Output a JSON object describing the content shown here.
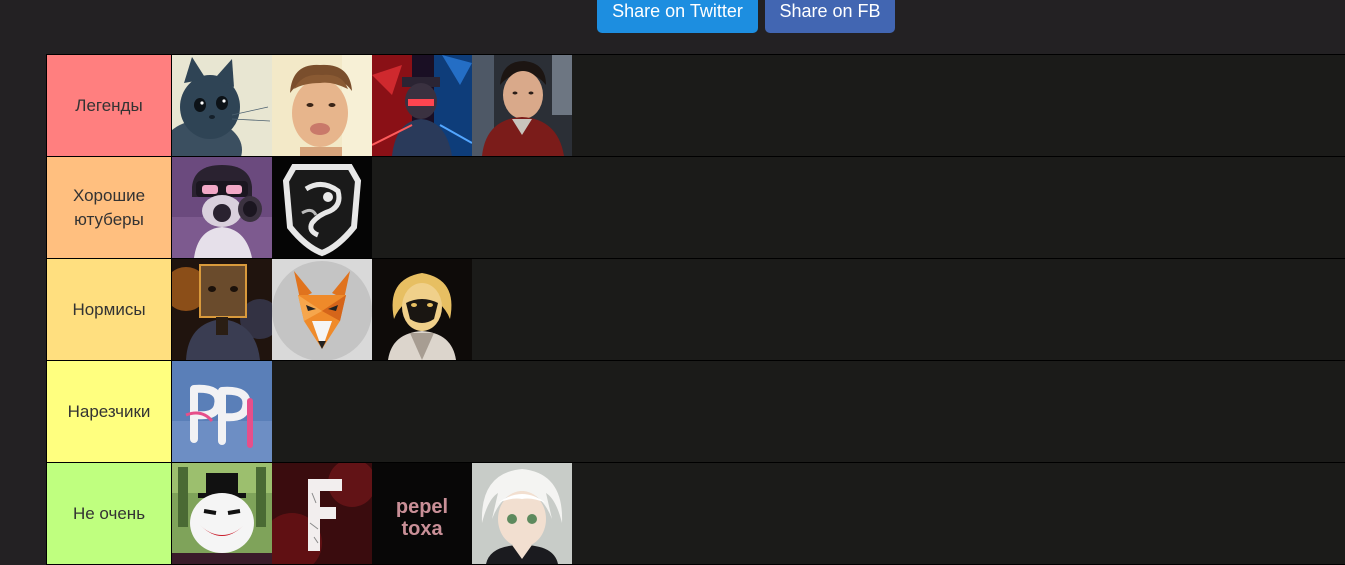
{
  "share": {
    "twitter_label": "Share on Twitter",
    "fb_label": "Share on FB"
  },
  "tiers": [
    {
      "label": "Легенды",
      "color": "#ff7f7f",
      "items": [
        {
          "icon": "cat-avatar-icon"
        },
        {
          "icon": "boy-avatar-icon"
        },
        {
          "icon": "neon-figure-avatar-icon"
        },
        {
          "icon": "man-jacket-avatar-icon"
        }
      ]
    },
    {
      "label": "Хорошие ютуберы",
      "color": "#ffbf7f",
      "items": [
        {
          "icon": "gasmask-avatar-icon"
        },
        {
          "icon": "shield-emblem-avatar-icon"
        }
      ]
    },
    {
      "label": "Нормисы",
      "color": "#ffdf7f",
      "items": [
        {
          "icon": "boxhead-avatar-icon"
        },
        {
          "icon": "fox-avatar-icon"
        },
        {
          "icon": "masked-girl-avatar-icon"
        }
      ]
    },
    {
      "label": "Нарезчики",
      "color": "#ffff7f",
      "items": [
        {
          "icon": "letters-logo-avatar-icon"
        }
      ]
    },
    {
      "label": "Не очень",
      "color": "#bfff7f",
      "items": [
        {
          "icon": "joker-avatar-icon"
        },
        {
          "icon": "letter-f-avatar-icon"
        },
        {
          "icon": "pepel-toxa-logo-icon",
          "text_line1": "pepel",
          "text_line2": "toxa"
        },
        {
          "icon": "anime-boy-avatar-icon"
        }
      ]
    }
  ]
}
